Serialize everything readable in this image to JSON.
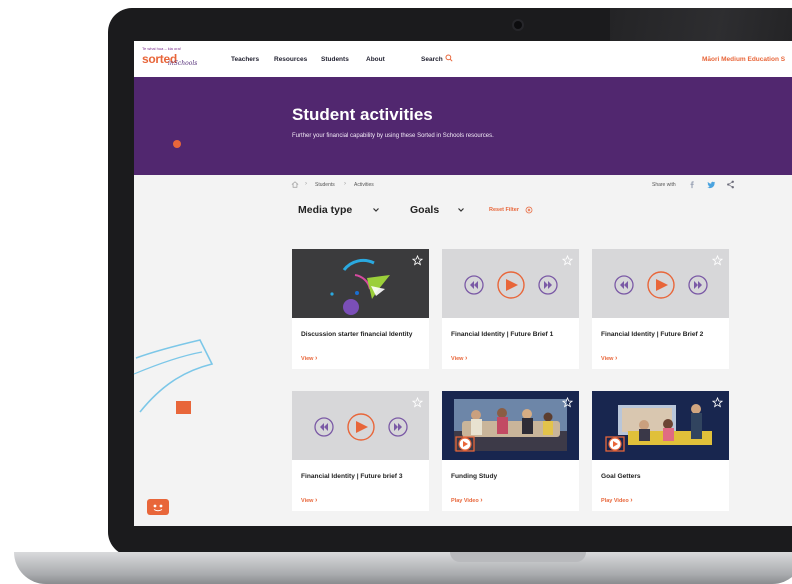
{
  "nav": {
    "logo_tagline": "Te whai hua – kia ora!",
    "logo_main": "sorted",
    "logo_sub": "inSchools",
    "links": [
      "Teachers",
      "Resources",
      "Students",
      "About"
    ],
    "search_label": "Search",
    "maori_link": "Māori Medium Education S"
  },
  "hero": {
    "title": "Student activities",
    "subtitle": "Further your financial capability by using these Sorted in Schools resources."
  },
  "breadcrumb": {
    "items": [
      "Students",
      "Activities"
    ],
    "share_label": "Share with"
  },
  "filters": {
    "media_type": "Media type",
    "goals": "Goals",
    "reset": "Reset Filter"
  },
  "cards": [
    {
      "title": "Discussion starter financial Identity",
      "link": "View",
      "thumb": "abstract-art"
    },
    {
      "title": "Financial Identity | Future Brief 1",
      "link": "View",
      "thumb": "video-player"
    },
    {
      "title": "Financial Identity | Future Brief 2",
      "link": "View",
      "thumb": "video-player"
    },
    {
      "title": "Financial Identity | Future brief 3",
      "link": "View",
      "thumb": "video-player"
    },
    {
      "title": "Funding Study",
      "link": "Play Video",
      "thumb": "video-photo"
    },
    {
      "title": "Goal Getters",
      "link": "Play Video",
      "thumb": "video-photo"
    }
  ],
  "colors": {
    "accent": "#e8663a",
    "hero_purple": "#51276f",
    "player_purple": "#7b5aa6",
    "navy": "#18264f"
  },
  "icons": [
    "search-icon",
    "home-icon",
    "facebook-icon",
    "twitter-icon",
    "share-icon",
    "chevron-down-icon",
    "close-circle-icon",
    "star-icon",
    "play-icon",
    "rewind-icon",
    "fast-forward-icon",
    "chat-bot-icon"
  ]
}
